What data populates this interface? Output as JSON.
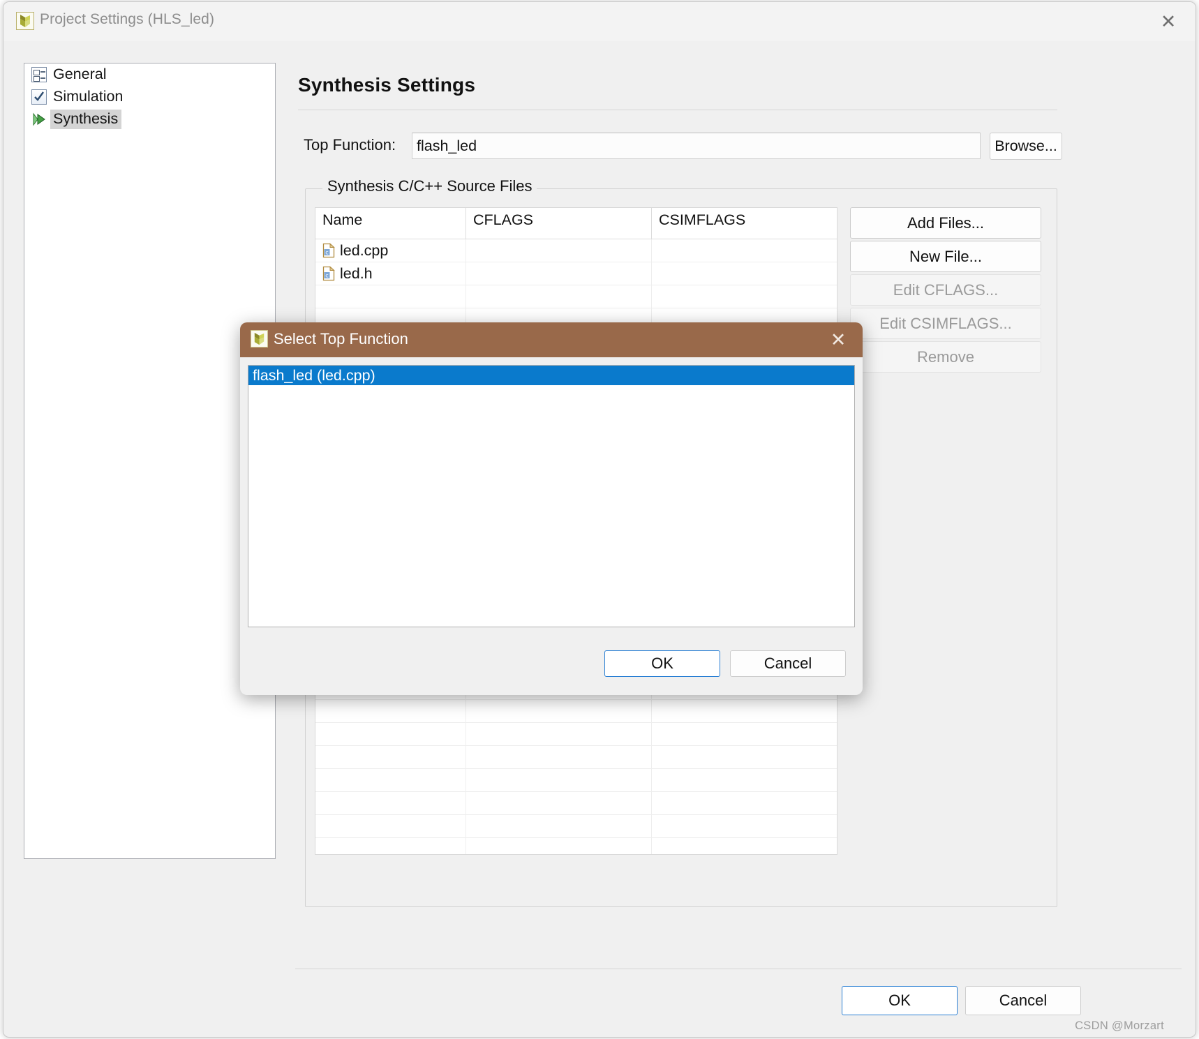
{
  "window": {
    "title": "Project Settings (HLS_led)",
    "icon": "vivado-logo-icon",
    "close_label": "✕"
  },
  "sidebar": {
    "items": [
      {
        "label": "General",
        "icon": "properties-list-icon",
        "selected": false
      },
      {
        "label": "Simulation",
        "icon": "checkbox-check-icon",
        "selected": false
      },
      {
        "label": "Synthesis",
        "icon": "green-play-icon",
        "selected": true
      }
    ]
  },
  "main": {
    "page_title": "Synthesis Settings",
    "top_function": {
      "label": "Top Function:",
      "value": "flash_led",
      "placeholder": "",
      "browse_label": "Browse..."
    },
    "source_group": {
      "legend": "Synthesis C/C++ Source Files",
      "columns": [
        "Name",
        "CFLAGS",
        "CSIMFLAGS"
      ],
      "rows": [
        {
          "name": "led.cpp",
          "icon": "c-file-icon",
          "cflags": "",
          "csimflags": ""
        },
        {
          "name": "led.h",
          "icon": "c-file-icon",
          "cflags": "",
          "csimflags": ""
        }
      ],
      "empty_row_count": 26,
      "buttons": [
        {
          "label": "Add Files...",
          "enabled": true
        },
        {
          "label": "New File...",
          "enabled": true
        },
        {
          "label": "Edit CFLAGS...",
          "enabled": false
        },
        {
          "label": "Edit CSIMFLAGS...",
          "enabled": false
        },
        {
          "label": "Remove",
          "enabled": false
        }
      ]
    },
    "footer_buttons": [
      {
        "label": "OK",
        "default": true
      },
      {
        "label": "Cancel",
        "default": false
      }
    ],
    "watermark": "CSDN @Morzart"
  },
  "modal": {
    "title": "Select Top Function",
    "icon": "vivado-logo-icon",
    "close_label": "✕",
    "list": [
      {
        "label": "flash_led (led.cpp)",
        "selected": true
      }
    ],
    "buttons": [
      {
        "label": "OK",
        "default": true
      },
      {
        "label": "Cancel",
        "default": false
      }
    ]
  },
  "colors": {
    "modal_titlebar": "#99694a",
    "selection_blue": "#0a7acc",
    "accent_focus": "#2a7fd4",
    "window_bg": "#f0f0f0"
  }
}
